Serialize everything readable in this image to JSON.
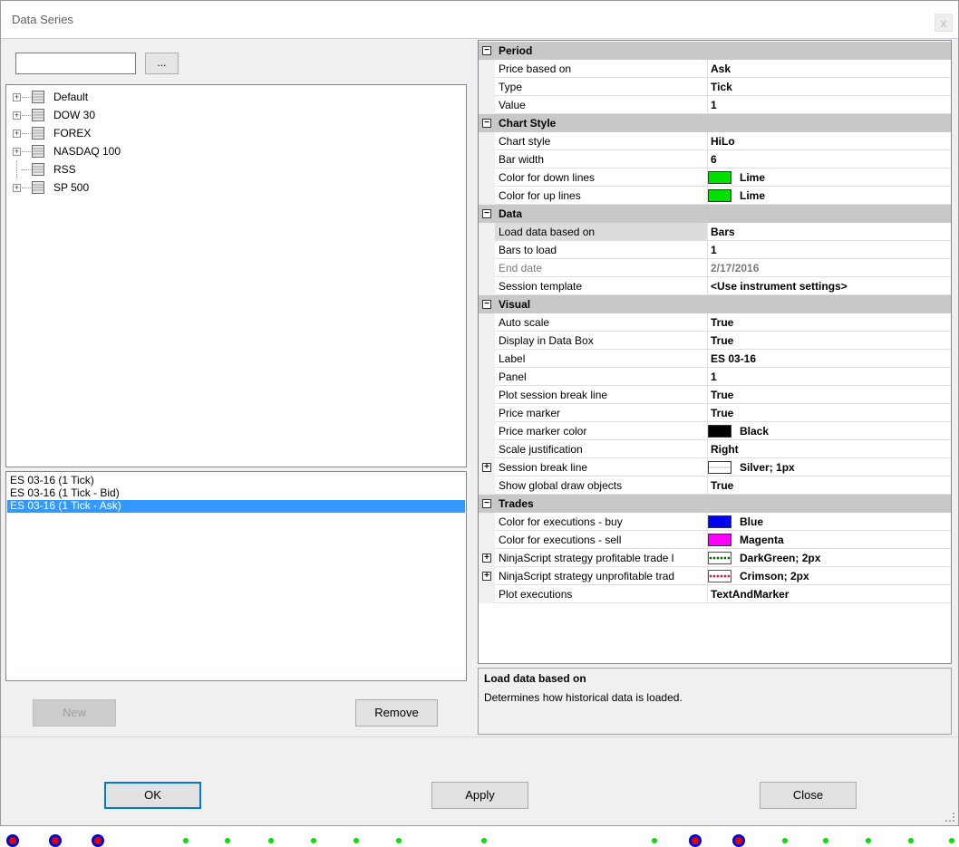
{
  "window": {
    "title": "Data Series",
    "close_label": "x"
  },
  "left": {
    "search": {
      "value": "",
      "placeholder": ""
    },
    "browse_label": "...",
    "tree_items": [
      {
        "label": "Default",
        "expandable": true
      },
      {
        "label": "DOW 30",
        "expandable": true
      },
      {
        "label": "FOREX",
        "expandable": true
      },
      {
        "label": "NASDAQ 100",
        "expandable": true
      },
      {
        "label": "RSS",
        "expandable": false
      },
      {
        "label": "SP 500",
        "expandable": true
      }
    ],
    "series": [
      {
        "label": "ES 03-16 (1 Tick)",
        "selected": false
      },
      {
        "label": "ES 03-16 (1 Tick - Bid)",
        "selected": false
      },
      {
        "label": "ES 03-16 (1 Tick - Ask)",
        "selected": true
      }
    ],
    "new_label": "New",
    "remove_label": "Remove"
  },
  "grid": {
    "categories": [
      {
        "name": "Period",
        "props": [
          {
            "name": "Price based on",
            "value": "Ask"
          },
          {
            "name": "Type",
            "value": "Tick"
          },
          {
            "name": "Value",
            "value": "1"
          }
        ]
      },
      {
        "name": "Chart Style",
        "props": [
          {
            "name": "Chart style",
            "value": "HiLo"
          },
          {
            "name": "Bar width",
            "value": "6"
          },
          {
            "name": "Color for down lines",
            "value": "Lime",
            "swatch": "#00e000"
          },
          {
            "name": "Color for up lines",
            "value": "Lime",
            "swatch": "#00e000"
          }
        ]
      },
      {
        "name": "Data",
        "props": [
          {
            "name": "Load data based on",
            "value": "Bars",
            "selected": true
          },
          {
            "name": "Bars to load",
            "value": "1"
          },
          {
            "name": "End date",
            "value": "2/17/2016",
            "dim": true
          },
          {
            "name": "Session template",
            "value": "<Use instrument settings>"
          }
        ]
      },
      {
        "name": "Visual",
        "props": [
          {
            "name": "Auto scale",
            "value": "True"
          },
          {
            "name": "Display in Data Box",
            "value": "True"
          },
          {
            "name": "Label",
            "value": "ES 03-16"
          },
          {
            "name": "Panel",
            "value": "1"
          },
          {
            "name": "Plot session break line",
            "value": "True"
          },
          {
            "name": "Price marker",
            "value": "True"
          },
          {
            "name": "Price marker color",
            "value": "Black",
            "swatch": "#000000"
          },
          {
            "name": "Scale justification",
            "value": "Right"
          },
          {
            "name": "Session break line",
            "value": "Silver; 1px",
            "swatch": "#ffffff",
            "expandable": true,
            "line": "#bfbfbf"
          },
          {
            "name": "Show global draw objects",
            "value": "True"
          }
        ]
      },
      {
        "name": "Trades",
        "props": [
          {
            "name": "Color for executions - buy",
            "value": "Blue",
            "swatch": "#0000ee"
          },
          {
            "name": "Color for executions - sell",
            "value": "Magenta",
            "swatch": "#ff00ff"
          },
          {
            "name": "NinjaScript strategy profitable trade l",
            "value": "DarkGreen; 2px",
            "swatch": "dotted",
            "dotcolor": "#006400",
            "expandable": true
          },
          {
            "name": "NinjaScript strategy unprofitable trad",
            "value": "Crimson; 2px",
            "swatch": "dotted",
            "dotcolor": "#dc143c",
            "expandable": true
          },
          {
            "name": "Plot executions",
            "value": "TextAndMarker"
          }
        ]
      }
    ]
  },
  "description": {
    "title": "Load data based on",
    "text": "Determines how historical data is loaded."
  },
  "footer": {
    "ok_label": "OK",
    "apply_label": "Apply",
    "close_label": "Close"
  },
  "colors": {
    "selection": "#3399ff",
    "category_bg": "#c8c8c8",
    "accent": "#0078d7"
  }
}
